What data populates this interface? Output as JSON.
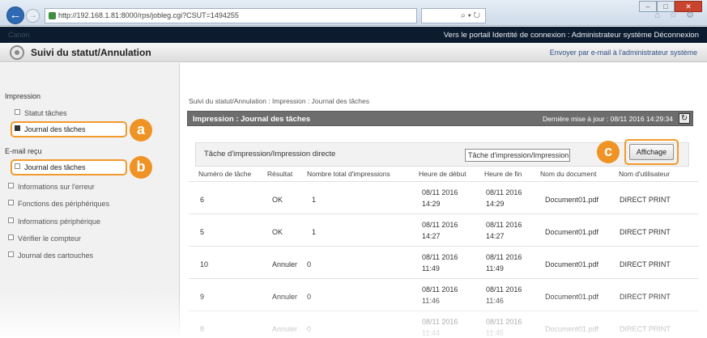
{
  "browser": {
    "address": "http://192.168.1.81:8000/rps/jobleg.cgi?CSUT=1494255",
    "tools": "⌕ ▾ ↻",
    "icons": "⌂ ☆ ⚙",
    "min": "–",
    "max": "□",
    "close": "✕"
  },
  "topbar": {
    "brand": "Canon",
    "links": "Vers le portail  Identité de connexion : Administrateur système Déconnexion"
  },
  "titlebar": {
    "title": "Suivi du statut/Annulation",
    "link": "Envoyer par e-mail à l'administrateur système"
  },
  "sidebar": {
    "section1": "Impression",
    "item_statut": "Statut tâches",
    "item_journal1": "Journal des tâches",
    "section2": "E-mail reçu",
    "item_journal2": "Journal des tâches",
    "links": [
      "Informations sur l'erreur",
      "Fonctions des périphériques",
      "Informations périphérique",
      "Vérifier le compteur",
      "Journal des cartouches"
    ]
  },
  "callouts": {
    "a": "a",
    "b": "b",
    "c": "c"
  },
  "main": {
    "breadcrumb": "Suivi du statut/Annulation : Impression : Journal des tâches",
    "panel_title": "Impression : Journal des tâches",
    "last_update": "Dernière mise à jour : 08/11 2016 14:29:34",
    "refresh_icon": "↻",
    "filter_label": "Tâche d'impression/Impression directe",
    "filter_value": "Tâche d'impression/Impression",
    "display_button": "Affichage"
  },
  "table": {
    "headers": [
      "Numéro de tâche",
      "Résultat",
      "Nombre total d'impressions",
      "Heure de début",
      "Heure de fin",
      "Nom du document",
      "Nom d'utilisateur"
    ],
    "rows": [
      {
        "num": "6",
        "result": "OK",
        "total": "1",
        "start_date": "08/11 2016",
        "start_time": "14:29",
        "end_date": "08/11 2016",
        "end_time": "14:29",
        "doc": "Document01.pdf",
        "user": "DIRECT PRINT"
      },
      {
        "num": "5",
        "result": "OK",
        "total": "1",
        "start_date": "08/11 2016",
        "start_time": "14:27",
        "end_date": "08/11 2016",
        "end_time": "14:27",
        "doc": "Document01.pdf",
        "user": "DIRECT PRINT"
      },
      {
        "num": "10",
        "result": "Annuler",
        "total": "0",
        "start_date": "08/11 2016",
        "start_time": "11:49",
        "end_date": "08/11 2016",
        "end_time": "11:49",
        "doc": "Document01.pdf",
        "user": "DIRECT PRINT"
      },
      {
        "num": "9",
        "result": "Annuler",
        "total": "0",
        "start_date": "08/11 2016",
        "start_time": "11:46",
        "end_date": "08/11 2016",
        "end_time": "11:46",
        "doc": "Document01.pdf",
        "user": "DIRECT PRINT"
      },
      {
        "num": "8",
        "result": "Annuler",
        "total": "0",
        "start_date": "08/11 2016",
        "start_time": "11:44",
        "end_date": "08/11 2016",
        "end_time": "11:45",
        "doc": "Document01.pdf",
        "user": "DIRECT PRINT"
      }
    ]
  },
  "colors": {
    "accent": "#ef9324",
    "header_bar": "#0d1b2e",
    "panel_head": "#6d6d6d"
  }
}
